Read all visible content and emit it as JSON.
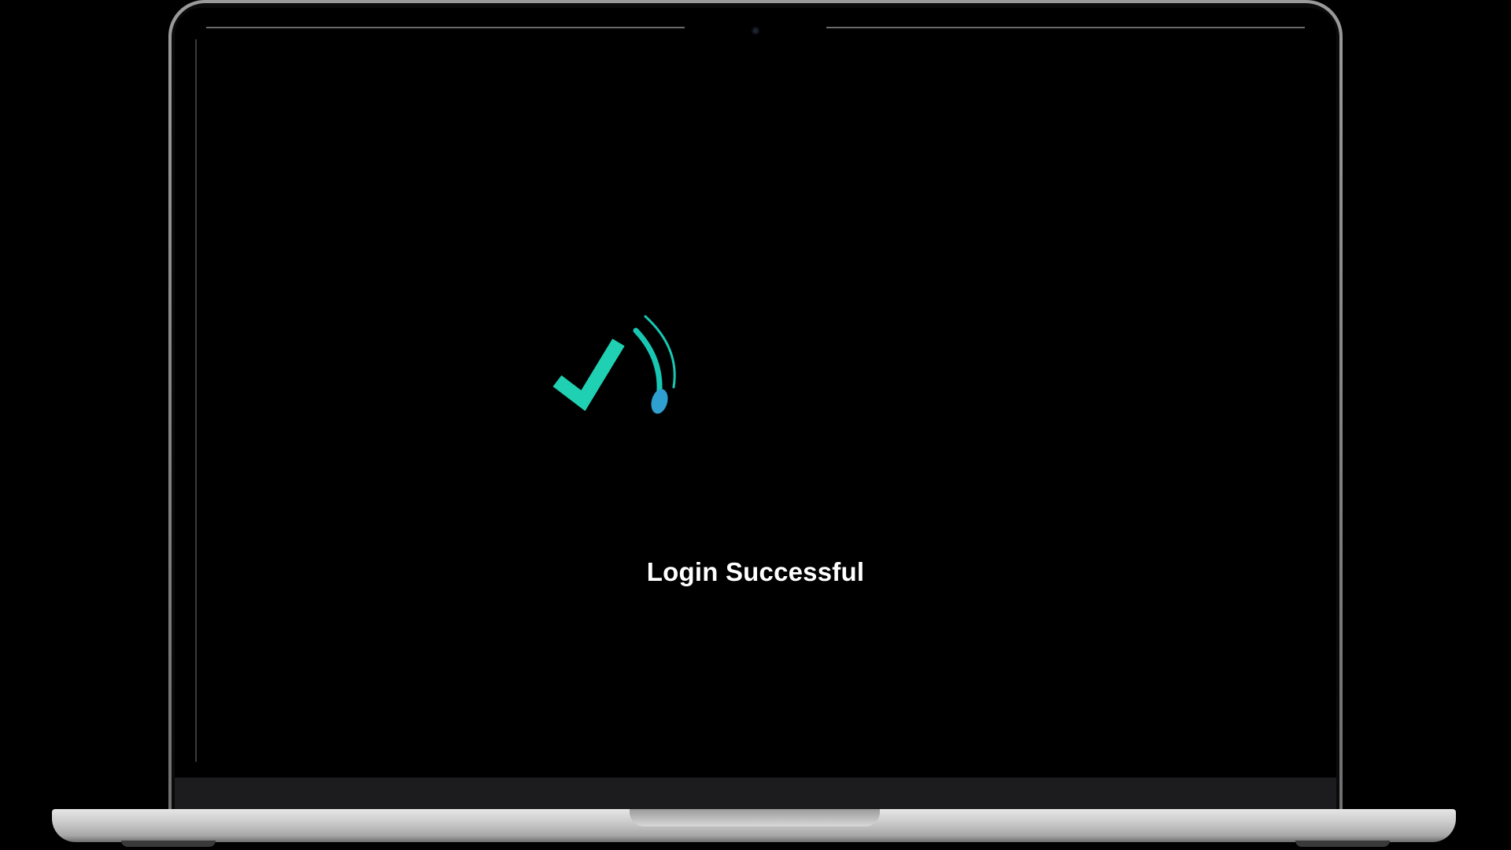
{
  "status": {
    "message": "Login Successful",
    "icon": "success-check-icon"
  },
  "colors": {
    "check": "#1fd1b2",
    "arc": "#18c7b3",
    "drop": "#2f9fd0",
    "background": "#000000",
    "text": "#ffffff"
  }
}
